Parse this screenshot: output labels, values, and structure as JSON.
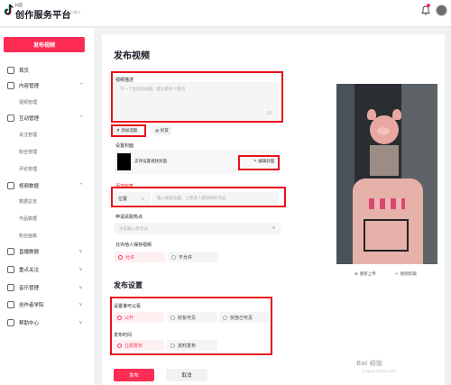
{
  "header": {
    "logo_small": "抖音",
    "logo_title": "创作服务平台",
    "logo_sub": "口袋 ▾",
    "icons": [
      "douyin-logo-icon",
      "bell-icon",
      "avatar"
    ],
    "accent_color": "#fe2c55"
  },
  "sidebar": {
    "publish_button": "发布视频",
    "items": [
      {
        "label": "首页",
        "icon": "home-icon"
      },
      {
        "label": "内容管理",
        "icon": "content-icon"
      },
      {
        "sub": "视频管理"
      },
      {
        "label": "互动管理",
        "icon": "interaction-icon"
      },
      {
        "sub": "关注管理"
      },
      {
        "sub": "粉丝管理"
      },
      {
        "sub": "评论管理"
      },
      {
        "label": "视频数据",
        "icon": "data-icon"
      },
      {
        "sub": "数据总览"
      },
      {
        "sub": "作品数据"
      },
      {
        "sub": "粉丝画像"
      },
      {
        "label": "直播数据",
        "icon": "live-icon"
      },
      {
        "label": "重点关注",
        "icon": "focus-icon"
      },
      {
        "label": "音乐管理",
        "icon": "music-icon"
      },
      {
        "label": "创作者学院",
        "icon": "academy-icon"
      },
      {
        "label": "帮助中心",
        "icon": "help-icon"
      }
    ]
  },
  "main": {
    "title": "发布视频",
    "description": {
      "label": "视频描述",
      "placeholder": "写一个合适的标题，能让更多人看到",
      "count": "55"
    },
    "chips": {
      "topic": "# 添加话题",
      "friend": "@ 好友"
    },
    "cover": {
      "label": "设置封面",
      "hint": "支持设置视频封面",
      "edit": "编辑封面"
    },
    "location": {
      "label": "添加标签",
      "select_value": "位置",
      "input_placeholder": "输入相关位置，让更多人看到你的作品"
    },
    "hotspot": {
      "label": "申请关联热点",
      "placeholder": "点击输入热点词"
    },
    "allow_save": {
      "label": "允许他人保存视频",
      "options": [
        "允许",
        "不允许"
      ],
      "selected": "允许"
    },
    "settings": {
      "title": "发布设置",
      "visibility_label": "设置谁可以看",
      "visibility_options": [
        "公开",
        "好友可见",
        "仅自己可见"
      ],
      "visibility_selected": "公开",
      "time_label": "发布时间",
      "time_options": [
        "立即发布",
        "定时发布"
      ],
      "time_selected": "立即发布"
    },
    "buttons": {
      "submit": "发布",
      "cancel": "取消"
    }
  },
  "preview": {
    "reupload": "重新上传",
    "edit": "视频剪辑"
  },
  "watermark": {
    "main": "Bai 经验",
    "sub": "jingyan.baidu.com"
  }
}
